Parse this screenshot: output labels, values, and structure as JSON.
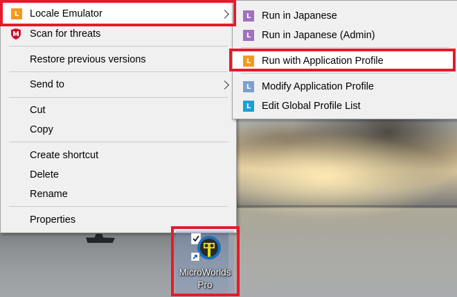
{
  "main_menu": {
    "items": [
      {
        "label": "Locale Emulator",
        "icon": "locale-emulator-icon",
        "submenu": true
      },
      {
        "label": "Scan for threats",
        "icon": "mcafee-shield-icon"
      },
      {
        "label": "Restore previous versions"
      },
      {
        "label": "Send to",
        "submenu": true
      },
      {
        "label": "Cut"
      },
      {
        "label": "Copy"
      },
      {
        "label": "Create shortcut"
      },
      {
        "label": "Delete"
      },
      {
        "label": "Rename"
      },
      {
        "label": "Properties"
      }
    ]
  },
  "sub_menu": {
    "items": [
      {
        "label": "Run in Japanese",
        "icon": "locale-emulator-purple-icon"
      },
      {
        "label": "Run in Japanese (Admin)",
        "icon": "locale-emulator-purple-icon"
      },
      {
        "label": "Run with Application Profile",
        "icon": "locale-emulator-orange-icon"
      },
      {
        "label": "Modify Application Profile",
        "icon": "locale-emulator-blue-icon"
      },
      {
        "label": "Edit Global Profile List",
        "icon": "locale-emulator-cyan-icon"
      }
    ]
  },
  "icon_letter": "L",
  "desktop_icon": {
    "label_line1": "MicroWorlds",
    "label_line2": "Pro"
  },
  "colors": {
    "highlight_box": "#e8192c",
    "le_orange": "#f39a1e",
    "le_purple": "#a070c0",
    "le_blue": "#7aa0d0",
    "le_cyan": "#1aa0d8",
    "mcafee_red": "#c8102e"
  }
}
